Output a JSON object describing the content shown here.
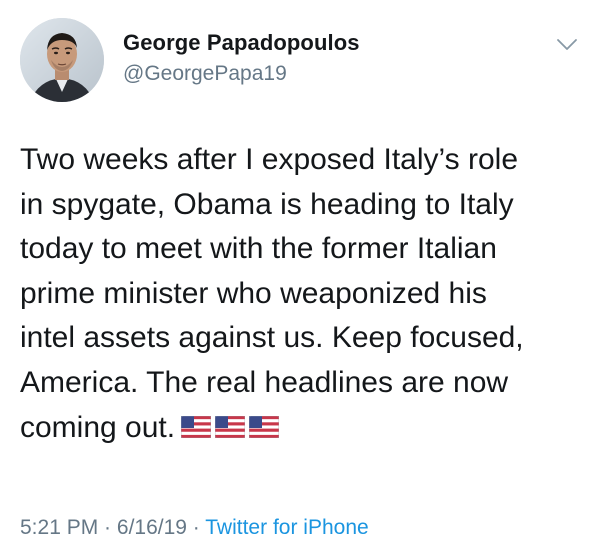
{
  "author": {
    "name": "George Papadopoulos",
    "handle": "@GeorgePapa19"
  },
  "tweet": {
    "lines": [
      "Two weeks after I exposed Italy’s role",
      "in spygate, Obama is heading to Italy",
      "today to meet with the former Italian",
      "prime minister who weaponized his",
      "intel assets against us. Keep focused,",
      "America. The real headlines are now",
      "coming out."
    ],
    "emoji": [
      "us-flag-icon",
      "us-flag-icon",
      "us-flag-icon"
    ]
  },
  "meta": {
    "time": "5:21 PM",
    "sep1": " · ",
    "date": "6/16/19",
    "sep2": " · ",
    "source": "Twitter for iPhone"
  },
  "colors": {
    "text": "#14171a",
    "secondary": "#657786",
    "link": "#1b95e0"
  }
}
